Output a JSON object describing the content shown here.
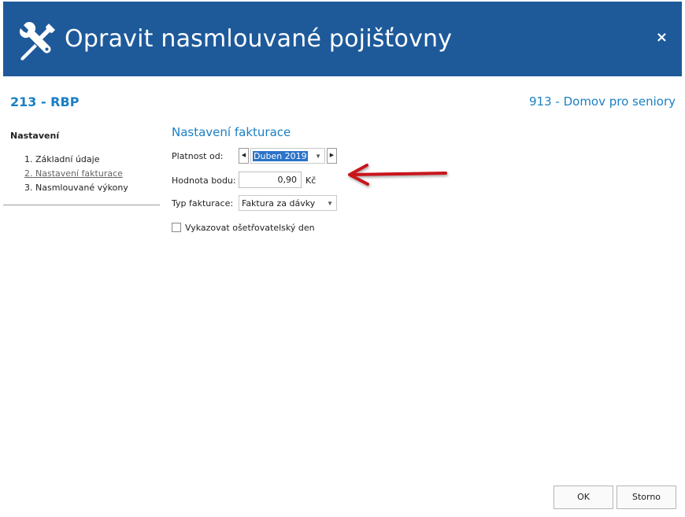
{
  "window": {
    "title": "Opravit nasmlouvané pojišťovny",
    "title_icon": "wrench-screwdriver-icon",
    "close_label": "×",
    "accent_color": "#1e5a9a"
  },
  "header": {
    "left": "213 - RBP",
    "right": "913 - Domov pro seniory"
  },
  "nav": {
    "heading": "Nastavení",
    "items": [
      {
        "label": "1. Základní údaje",
        "active": false
      },
      {
        "label": "2. Nastavení fakturace",
        "active": true
      },
      {
        "label": "3. Nasmlouvané výkony",
        "active": false
      }
    ]
  },
  "section": {
    "title": "Nastavení fakturace"
  },
  "form": {
    "validity": {
      "label": "Platnost od:",
      "value": "Duben 2019"
    },
    "point_value": {
      "label": "Hodnota bodu:",
      "value": "0,90",
      "unit": "Kč"
    },
    "billing_type": {
      "label": "Typ fakturace:",
      "value": "Faktura za dávky"
    },
    "nursing_day": {
      "label": "Vykazovat ošetřovatelský den",
      "checked": false
    }
  },
  "annotation": {
    "color": "#c8121c"
  },
  "footer": {
    "ok_label": "OK",
    "cancel_label": "Storno"
  }
}
